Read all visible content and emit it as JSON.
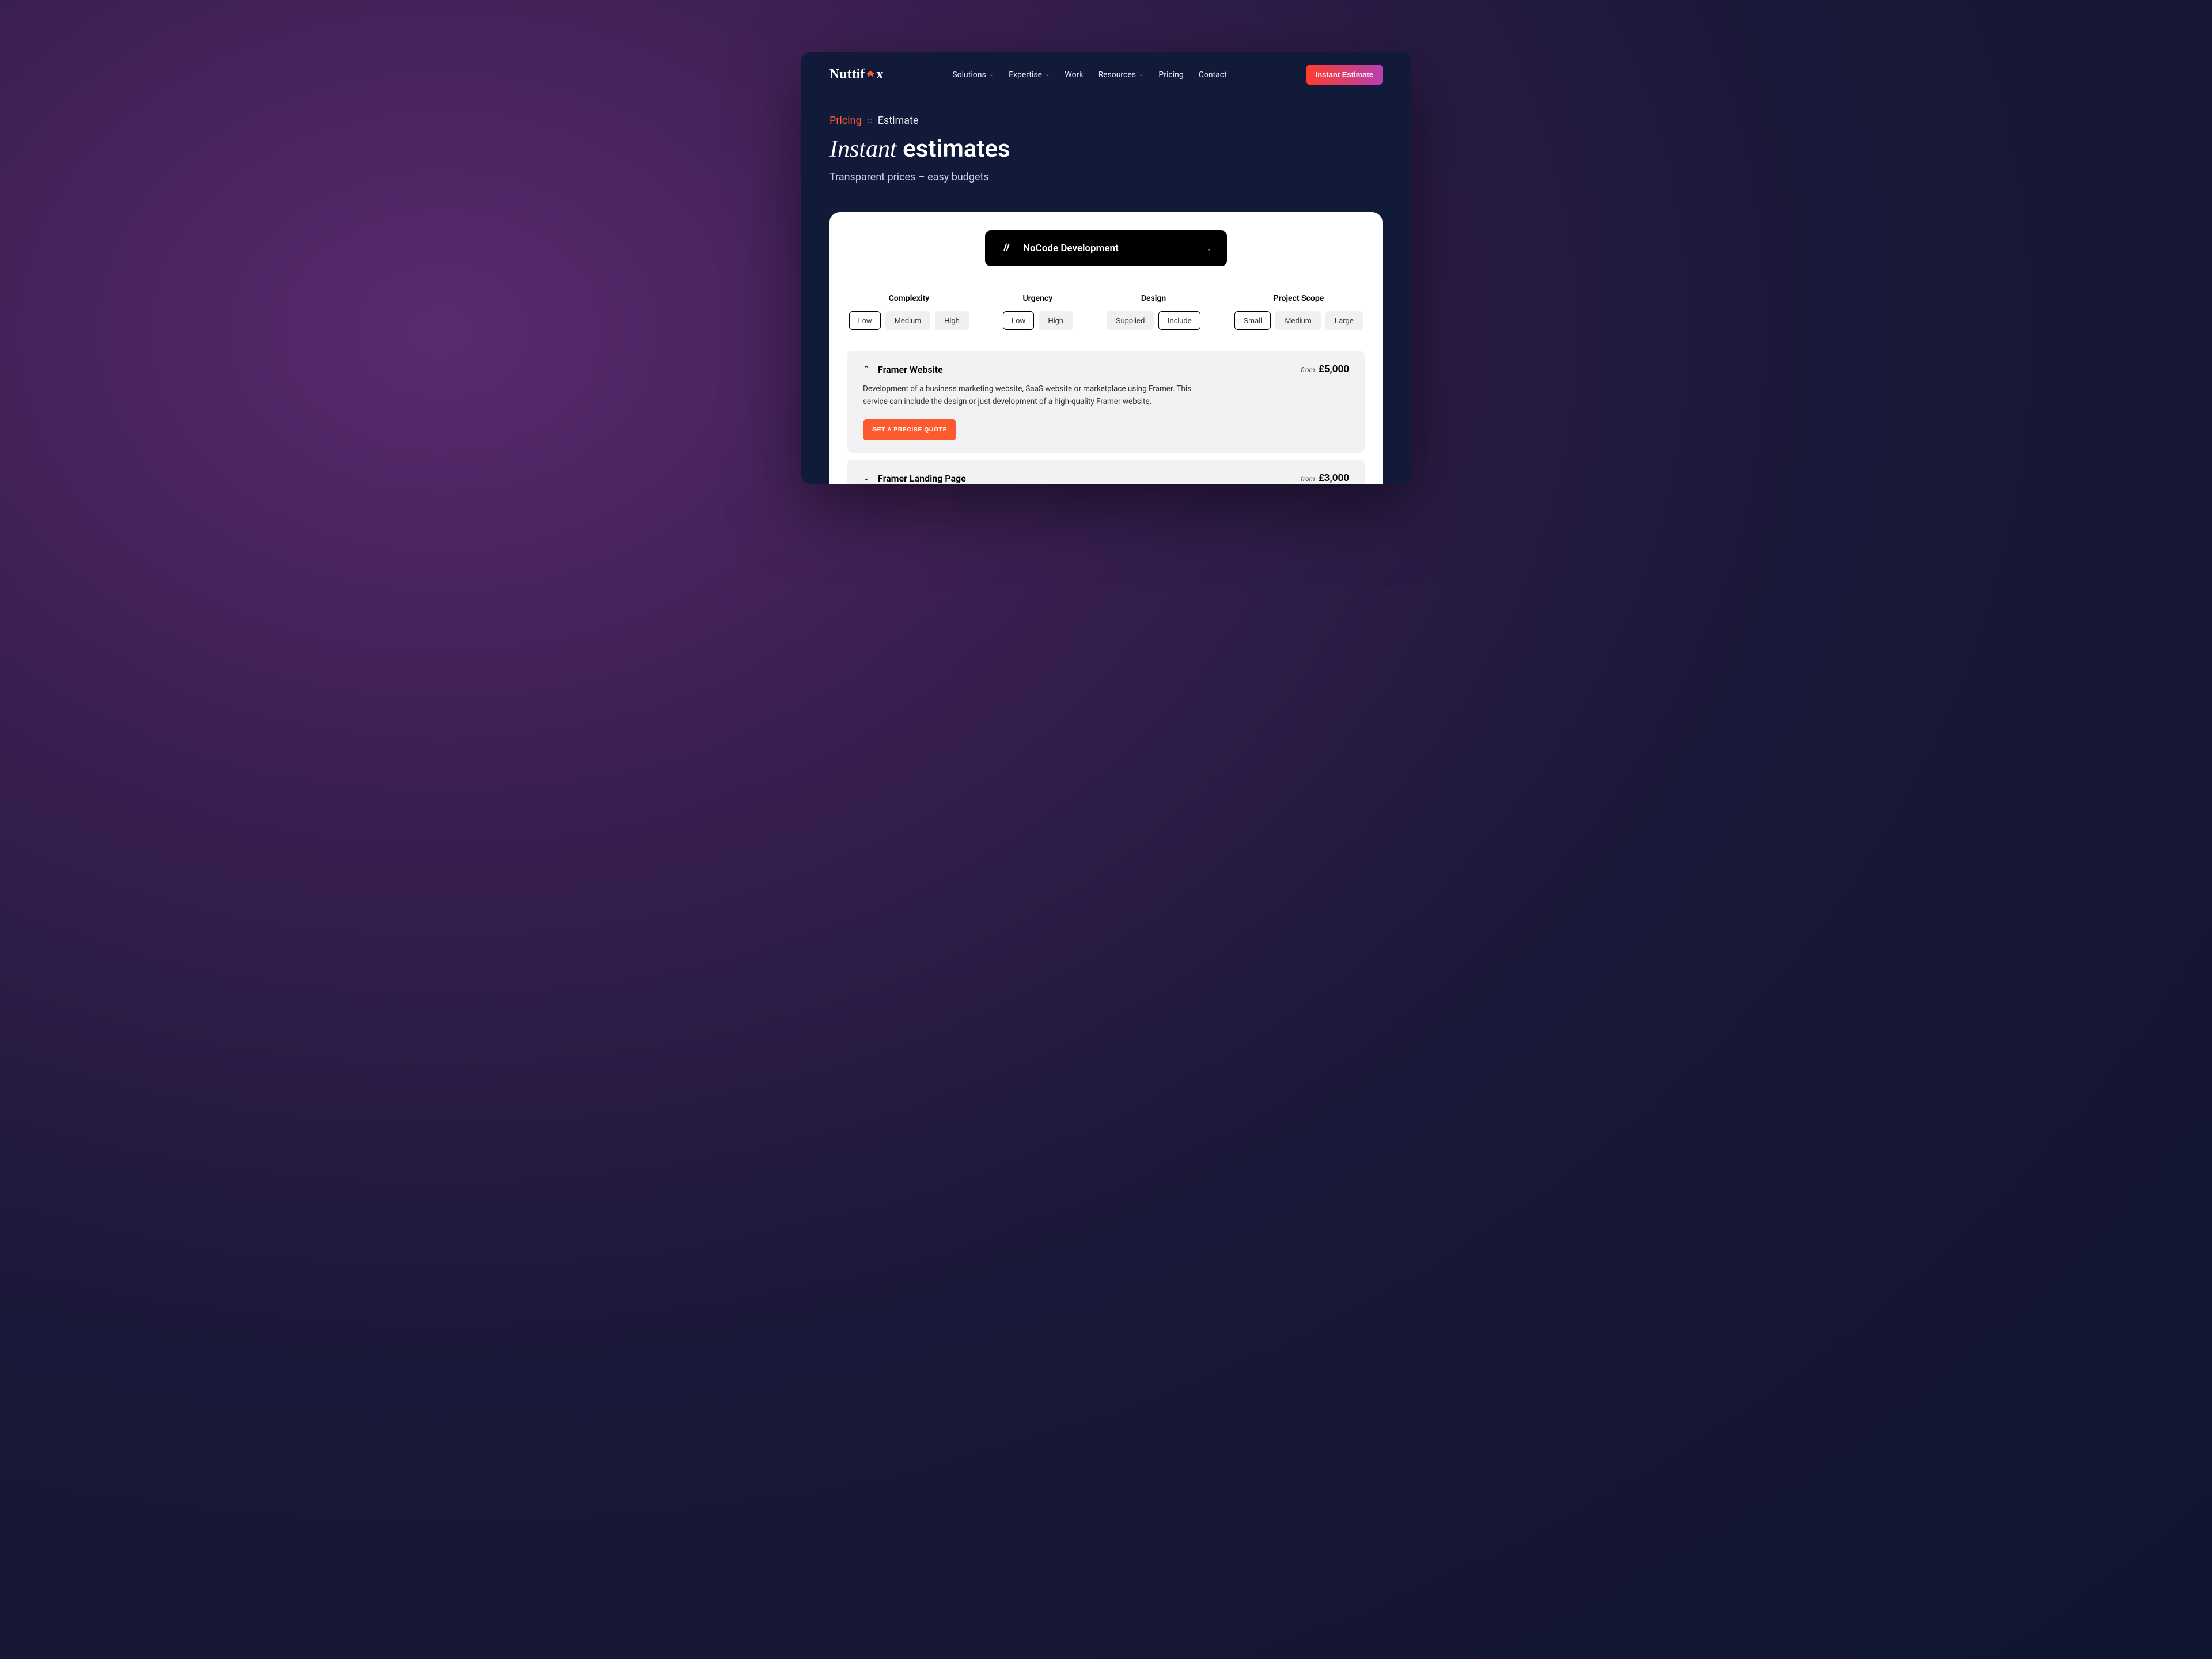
{
  "brand": {
    "name_pre": "Nuttif",
    "name_post": "x"
  },
  "nav": {
    "items": [
      {
        "label": "Solutions",
        "has_dropdown": true
      },
      {
        "label": "Expertise",
        "has_dropdown": true
      },
      {
        "label": "Work",
        "has_dropdown": false
      },
      {
        "label": "Resources",
        "has_dropdown": true
      },
      {
        "label": "Pricing",
        "has_dropdown": false
      },
      {
        "label": "Contact",
        "has_dropdown": false
      }
    ],
    "cta": "Instant Estimate"
  },
  "breadcrumb": {
    "part1": "Pricing",
    "part2": "Estimate"
  },
  "header": {
    "title_italic": "Instant",
    "title_rest": "estimates",
    "subtitle": "Transparent prices – easy budgets"
  },
  "dropdown": {
    "label": "NoCode Development"
  },
  "filters": [
    {
      "label": "Complexity",
      "options": [
        "Low",
        "Medium",
        "High"
      ],
      "selected": "Low"
    },
    {
      "label": "Urgency",
      "options": [
        "Low",
        "High"
      ],
      "selected": "Low"
    },
    {
      "label": "Design",
      "options": [
        "Supplied",
        "Include"
      ],
      "selected": "Include"
    },
    {
      "label": "Project Scope",
      "options": [
        "Small",
        "Medium",
        "Large"
      ],
      "selected": "Small"
    }
  ],
  "accordion": [
    {
      "title": "Framer Website",
      "from_label": "from",
      "price": "£5,000",
      "expanded": true,
      "description": "Development of a business marketing website, SaaS website or marketplace using Framer. This service can include the design or just development of a high-quality Framer website.",
      "cta": "GET A PRECISE QUOTE"
    },
    {
      "title": "Framer Landing Page",
      "from_label": "from",
      "price": "£3,000",
      "expanded": false
    }
  ]
}
